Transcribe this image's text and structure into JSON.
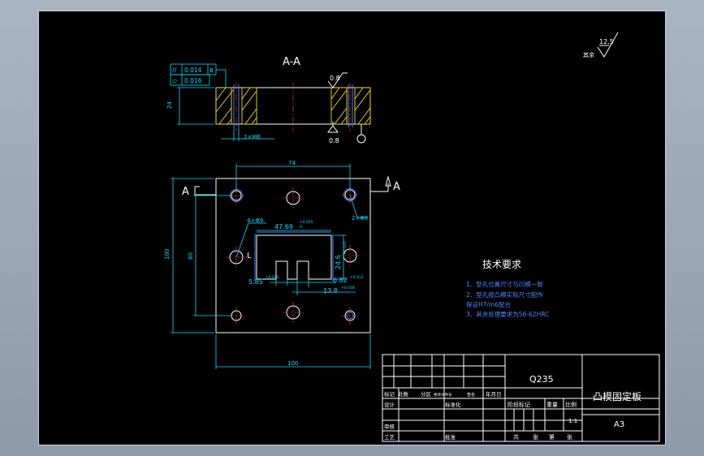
{
  "section_title": "A-A",
  "section_mark": "A",
  "tolerance_frame": {
    "row1_symbol": "//",
    "row1_value": "0.014",
    "row1_datum": "B",
    "row2_symbol": "▱",
    "row2_value": "0.016"
  },
  "roughness": {
    "value": "12.5",
    "rest_label": "其余",
    "top_face": "0.8",
    "bottom_face": "0.8"
  },
  "dimensions": {
    "thickness": "24",
    "pin_hole": "2×M6",
    "hole_spacing": "74",
    "plate_height": "100",
    "inner_height": "80",
    "plate_width": "100",
    "thread_holes": "2×Φ8",
    "small_hole": "4×Φ9",
    "slot_width": "47.69",
    "slot_width_tol": "+0.025",
    "slot_height": "24.6",
    "slot_height_tol": "+0.025",
    "notch_width": "5.85",
    "notch_width_tol": "+0.012",
    "notch_gap": "6.82",
    "notch_gap_tol": "+0.012",
    "notch_depth": "13.8",
    "notch_depth_tol": "+0.018",
    "small_tol": "0",
    "corner_label": "L"
  },
  "tech_req": {
    "title": "技术要求",
    "items": [
      "1、型孔位置尺寸与凹模一致",
      "2、型孔按凸模实际尺寸配作",
      "保证H7/m6配合",
      "3、其余处理要求为56-62HRC"
    ]
  },
  "title_block": {
    "material": "Q235",
    "part_name": "凸模固定板",
    "sheet_size": "A3",
    "scale": "1:1",
    "labels": {
      "mark": "标记",
      "count": "处数",
      "zone": "分区",
      "change_doc": "更改文件号",
      "sign": "签名",
      "date": "年月日",
      "design": "设计",
      "standardize": "标准化",
      "review": "审核",
      "process": "工艺",
      "approve": "批准",
      "stage": "阶段标记",
      "weight": "重量",
      "ratio": "比例",
      "total": "共",
      "sheets": "张",
      "page": "第",
      "sheets2": "张"
    }
  }
}
